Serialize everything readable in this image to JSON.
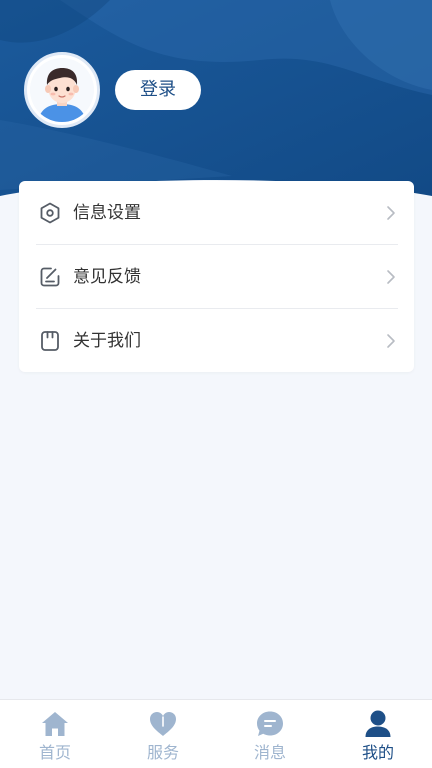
{
  "header": {
    "login_label": "登录",
    "bg_color": "#1a5797"
  },
  "menu": {
    "items": [
      {
        "label": "信息设置",
        "icon": "hexagon-settings-icon"
      },
      {
        "label": "意见反馈",
        "icon": "edit-feedback-icon"
      },
      {
        "label": "关于我们",
        "icon": "info-card-icon"
      }
    ]
  },
  "tabbar": {
    "active_color": "#1e4f87",
    "inactive_color": "#9fb5cf",
    "tabs": [
      {
        "label": "首页",
        "icon": "home-icon",
        "active": false
      },
      {
        "label": "服务",
        "icon": "heart-icon",
        "active": false
      },
      {
        "label": "消息",
        "icon": "chat-bubble-icon",
        "active": false
      },
      {
        "label": "我的",
        "icon": "user-icon",
        "active": true
      }
    ]
  }
}
